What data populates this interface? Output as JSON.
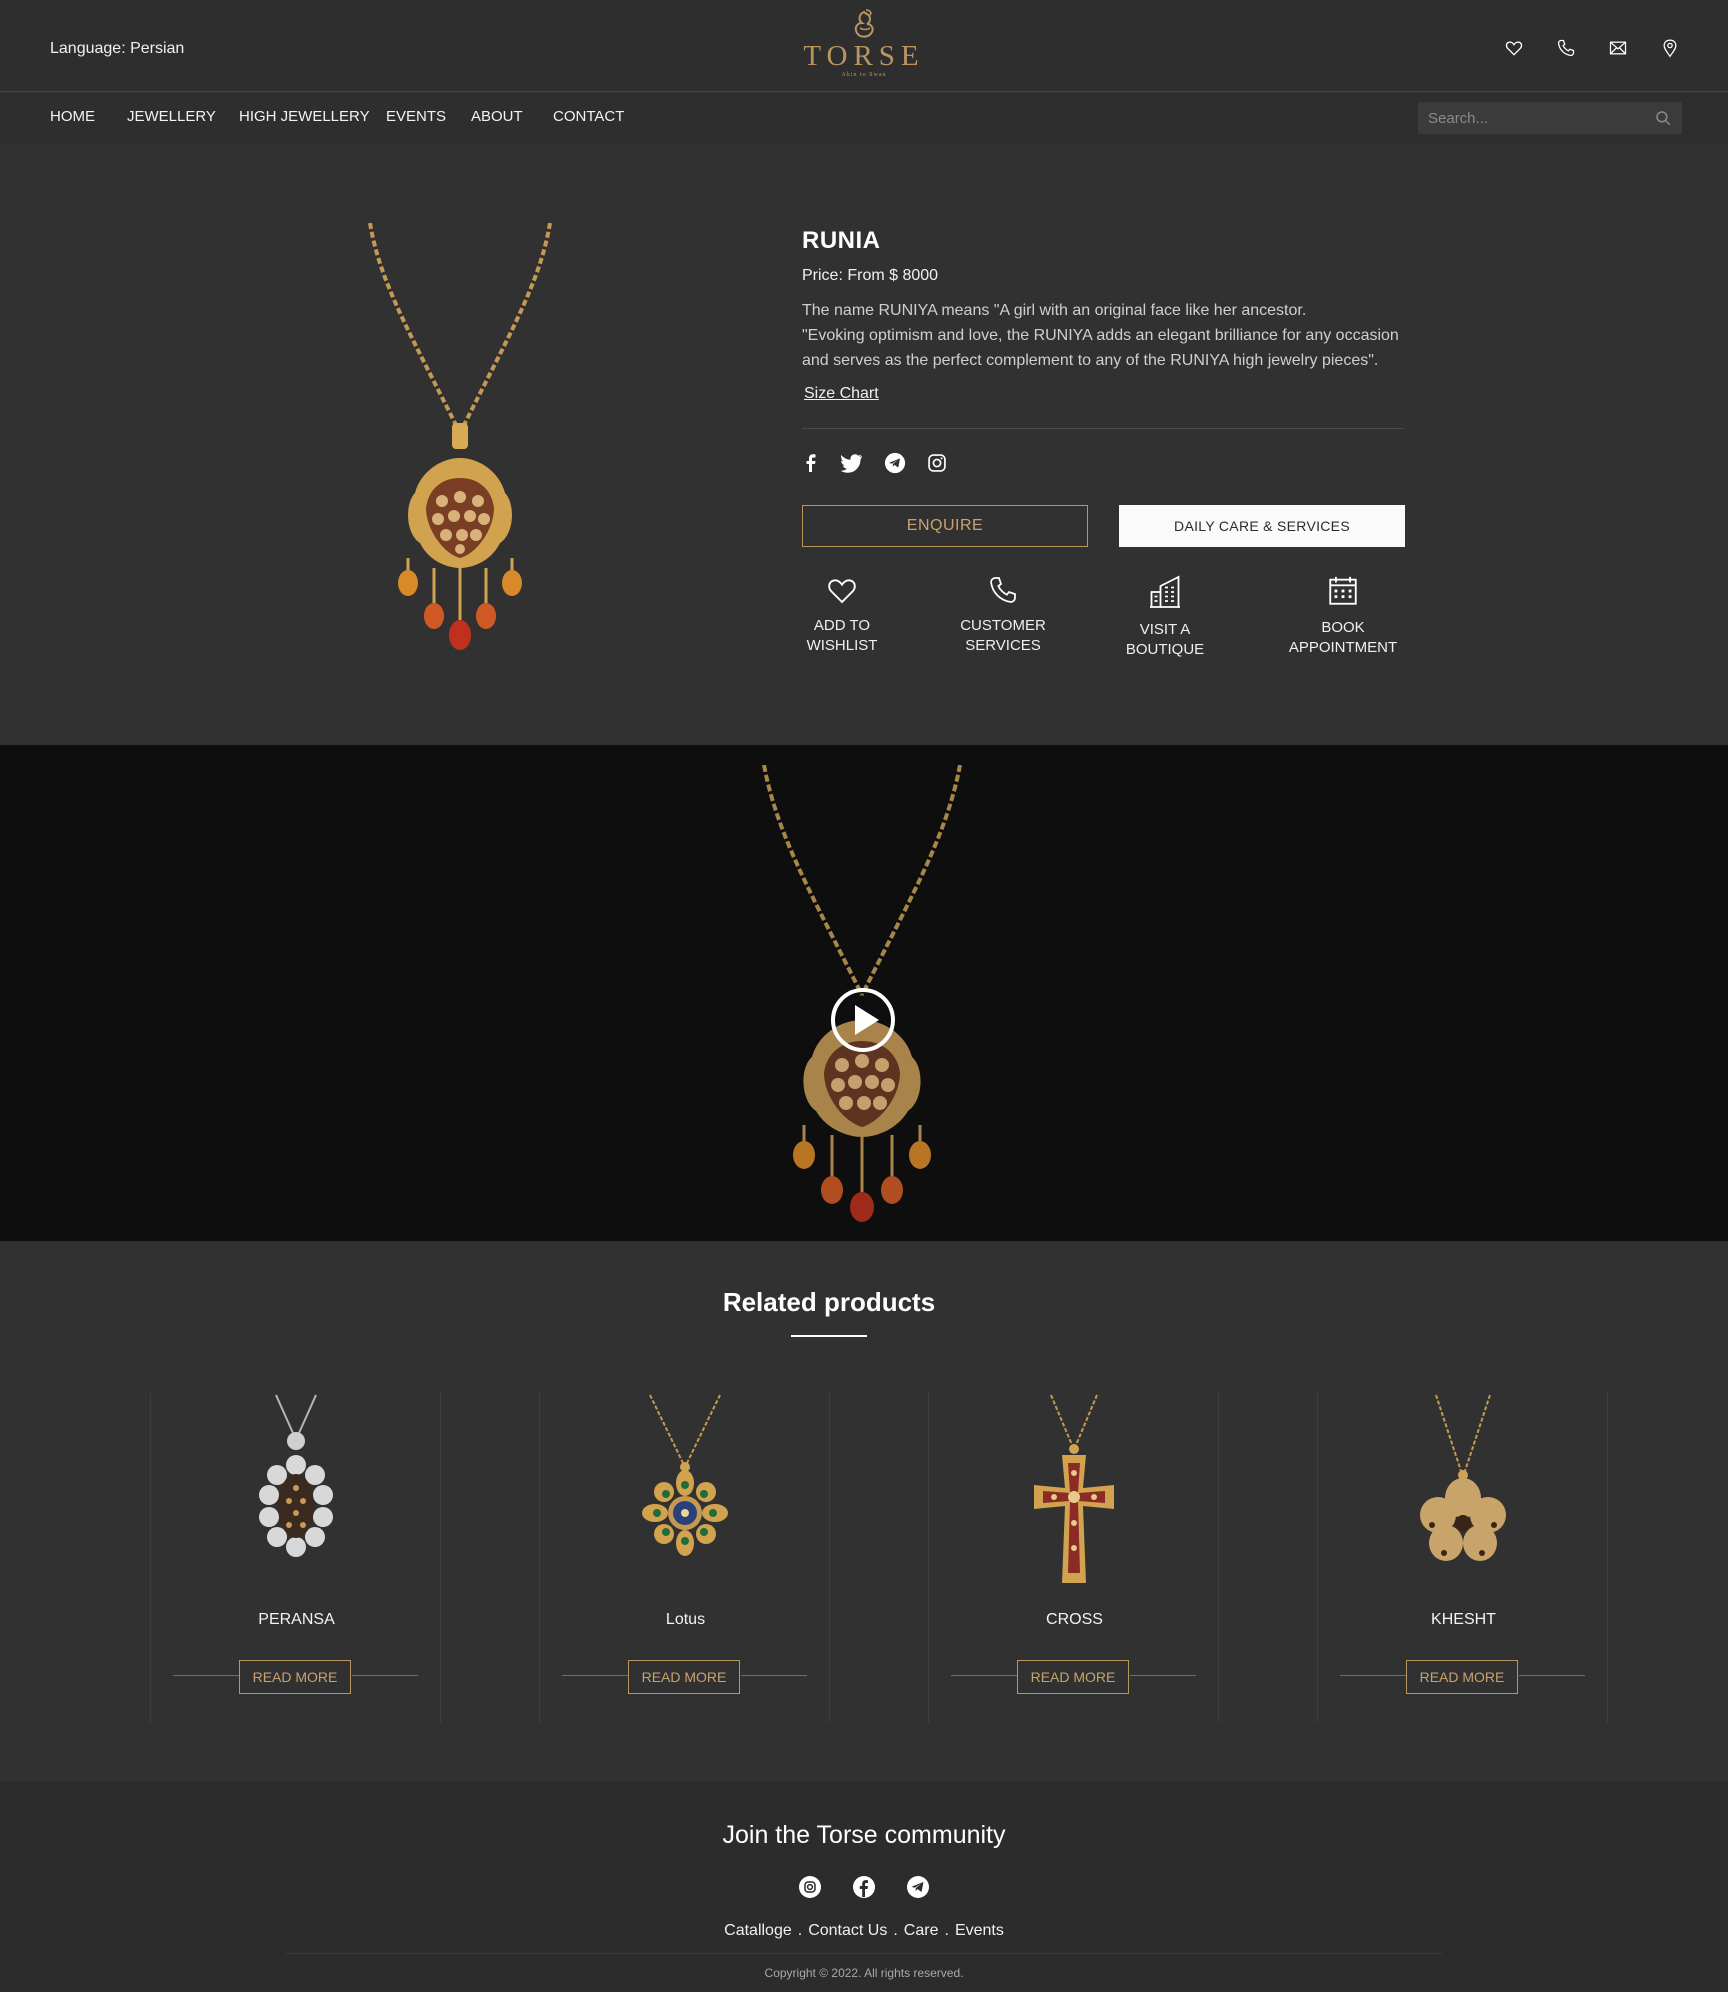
{
  "header": {
    "language_label": "Language: Persian",
    "logo_text": "TORSE",
    "logo_tagline": "Akin to Swan",
    "icons": [
      "heart-icon",
      "phone-icon",
      "mail-icon",
      "location-icon"
    ]
  },
  "nav": {
    "items": [
      {
        "label": "HOME"
      },
      {
        "label": "JEWELLERY"
      },
      {
        "label": "HIGH JEWELLERY"
      },
      {
        "label": "EVENTS"
      },
      {
        "label": "ABOUT"
      },
      {
        "label": "CONTACT"
      }
    ],
    "search_placeholder": "Search..."
  },
  "product": {
    "title": "RUNIA",
    "price": "Price: From $ 8000",
    "description_line1": "The name RUNIYA means \"A girl with an original face like her ancestor.",
    "description_line2": "\"Evoking optimism and love, the RUNIYA adds an elegant brilliance for any occasion and serves as the perfect complement to any of the RUNIYA high jewelry pieces\".",
    "size_chart": "Size Chart",
    "share_icons": [
      "facebook-icon",
      "twitter-icon",
      "telegram-icon",
      "instagram-icon"
    ],
    "enquire_label": "ENQUIRE",
    "care_label": "DAILY CARE & SERVICES",
    "actions": [
      {
        "label": "ADD TO\nWISHLIST",
        "icon": "heart-icon"
      },
      {
        "label": "CUSTOMER\nSERVICES",
        "icon": "phone-icon"
      },
      {
        "label": "VISIT A\nBOUTIQUE",
        "icon": "building-icon"
      },
      {
        "label": "BOOK\nAPPOINTMENT",
        "icon": "calendar-icon"
      }
    ]
  },
  "video": {
    "icon": "play-icon"
  },
  "related": {
    "title": "Related products",
    "read_more": "READ MORE",
    "items": [
      {
        "name": "PERANSA"
      },
      {
        "name": "Lotus"
      },
      {
        "name": "CROSS"
      },
      {
        "name": "KHESHT"
      }
    ]
  },
  "footer": {
    "join_title": "Join the Torse community",
    "social_icons": [
      "instagram-icon",
      "facebook-icon",
      "telegram-icon"
    ],
    "links": [
      "Catalloge",
      "Contact Us",
      "Care",
      "Events"
    ],
    "separator": ".",
    "copyright": "Copyright © 2022. All rights reserved."
  },
  "colors": {
    "background": "#313131",
    "video_background": "#0e0e0e",
    "accent_gold": "#b9965f",
    "text": "#ffffff"
  }
}
